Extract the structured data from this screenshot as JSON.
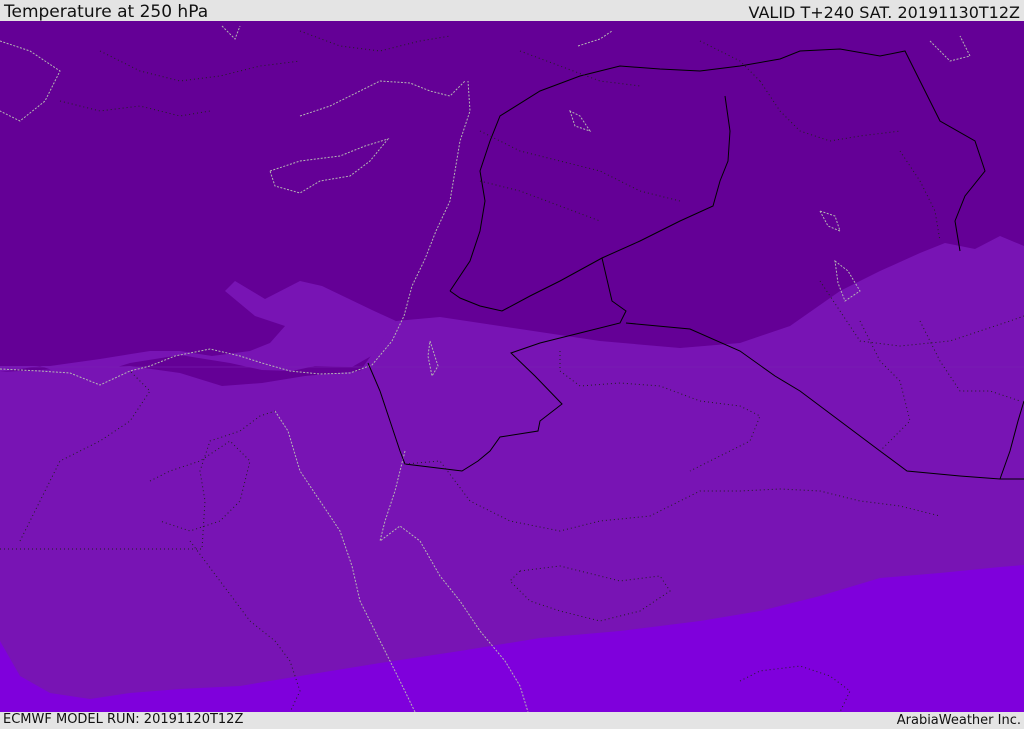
{
  "header": {
    "title": "Temperature at 250 hPa",
    "valid": "VALID T+240 SAT. 20191130T12Z"
  },
  "footer": {
    "model_run": "ECMWF MODEL RUN: 20191120T12Z",
    "credit": "ArabiaWeather Inc."
  },
  "colors": {
    "band_cold": "#640096",
    "band_mid": "#7814b4",
    "band_warm": "#7f00dc",
    "coastline": "#b4b4b4",
    "border": "#000000",
    "bar_background": "#e4e4e4"
  }
}
